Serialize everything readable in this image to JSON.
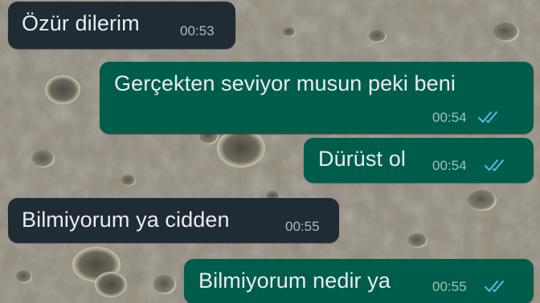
{
  "colors": {
    "incoming_bubble": "#1f2c34",
    "outgoing_bubble": "#005c4b",
    "read_ticks": "#53bdeb",
    "text": "#e9edef"
  },
  "wallpaper": {
    "icon": "moon-surface-wallpaper"
  },
  "messages": [
    {
      "direction": "incoming",
      "text": "Özür dilerim",
      "time": "00:53"
    },
    {
      "direction": "outgoing",
      "text": "Gerçekten seviyor musun peki beni",
      "time": "00:54",
      "status": "read",
      "status_icon": "double-check-icon"
    },
    {
      "direction": "outgoing",
      "text": "Dürüst ol",
      "time": "00:54",
      "status": "read",
      "status_icon": "double-check-icon"
    },
    {
      "direction": "incoming",
      "text": "Bilmiyorum ya cidden",
      "time": "00:55"
    },
    {
      "direction": "outgoing",
      "text": "Bilmiyorum nedir ya",
      "time": "00:55",
      "status": "read",
      "status_icon": "double-check-icon"
    }
  ]
}
